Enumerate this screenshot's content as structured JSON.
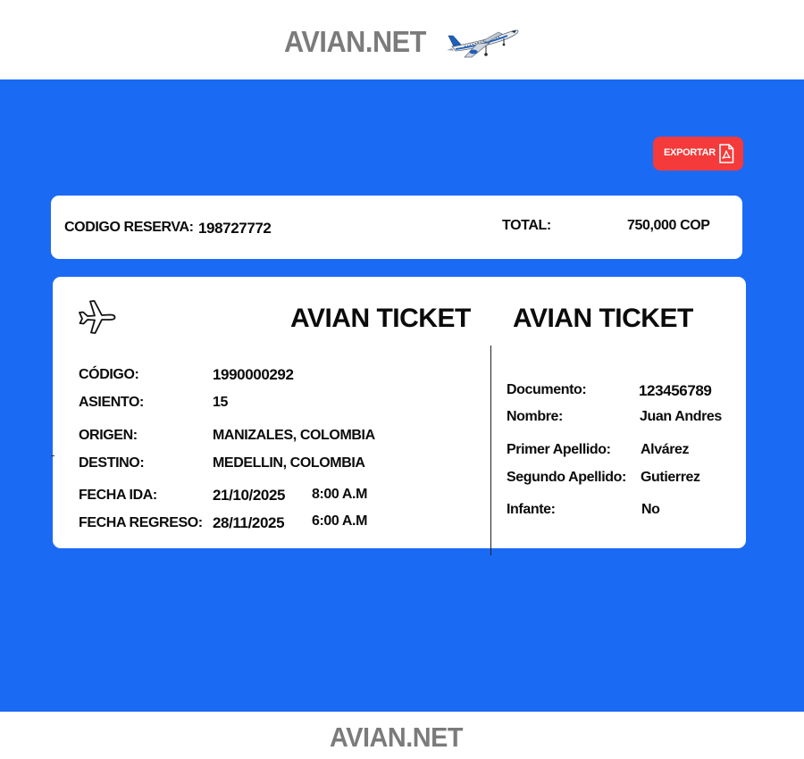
{
  "header": {
    "brand": "AVIAN.NET"
  },
  "toolbar": {
    "export_label": "EXPORTAR"
  },
  "reservation": {
    "code_label": "CODIGO RESERVA:",
    "code_value": "198727772",
    "total_label": "TOTAL:",
    "total_value": "750,000 COP"
  },
  "ticket": {
    "title_left": "AVIAN TICKET",
    "title_right": "AVIAN TICKET",
    "flight": {
      "codigo_label": "CÓDIGO:",
      "codigo_value": "1990000292",
      "asiento_label": "ASIENTO:",
      "asiento_value": "15",
      "origen_label": "ORIGEN:",
      "origen_value": "MANIZALES, COLOMBIA",
      "destino_label": "DESTINO:",
      "destino_value": "MEDELLIN, COLOMBIA",
      "fecha_ida_label": "FECHA IDA:",
      "fecha_ida_date": "21/10/2025",
      "fecha_ida_time": "8:00 A.M",
      "fecha_regreso_label": "FECHA REGRESO:",
      "fecha_regreso_date": "28/11/2025",
      "fecha_regreso_time": "6:00 A.M"
    },
    "passenger": {
      "documento_label": "Documento:",
      "documento_value": "123456789",
      "nombre_label": "Nombre:",
      "nombre_value": "Juan Andres",
      "primer_apellido_label": "Primer Apellido:",
      "primer_apellido_value": "Alvárez",
      "segundo_apellido_label": "Segundo Apellido:",
      "segundo_apellido_value": "Gutierrez",
      "infante_label": "Infante:",
      "infante_value": "No"
    }
  },
  "footer": {
    "brand": "AVIAN.NET"
  },
  "colors": {
    "band": "#1b6af4",
    "export": "#f43a3a",
    "brand_gray": "#7b7b7b"
  },
  "icons": {
    "logo": "airliner-illustration",
    "ticket": "airplane-outline-icon",
    "export": "pdf-file-icon"
  }
}
